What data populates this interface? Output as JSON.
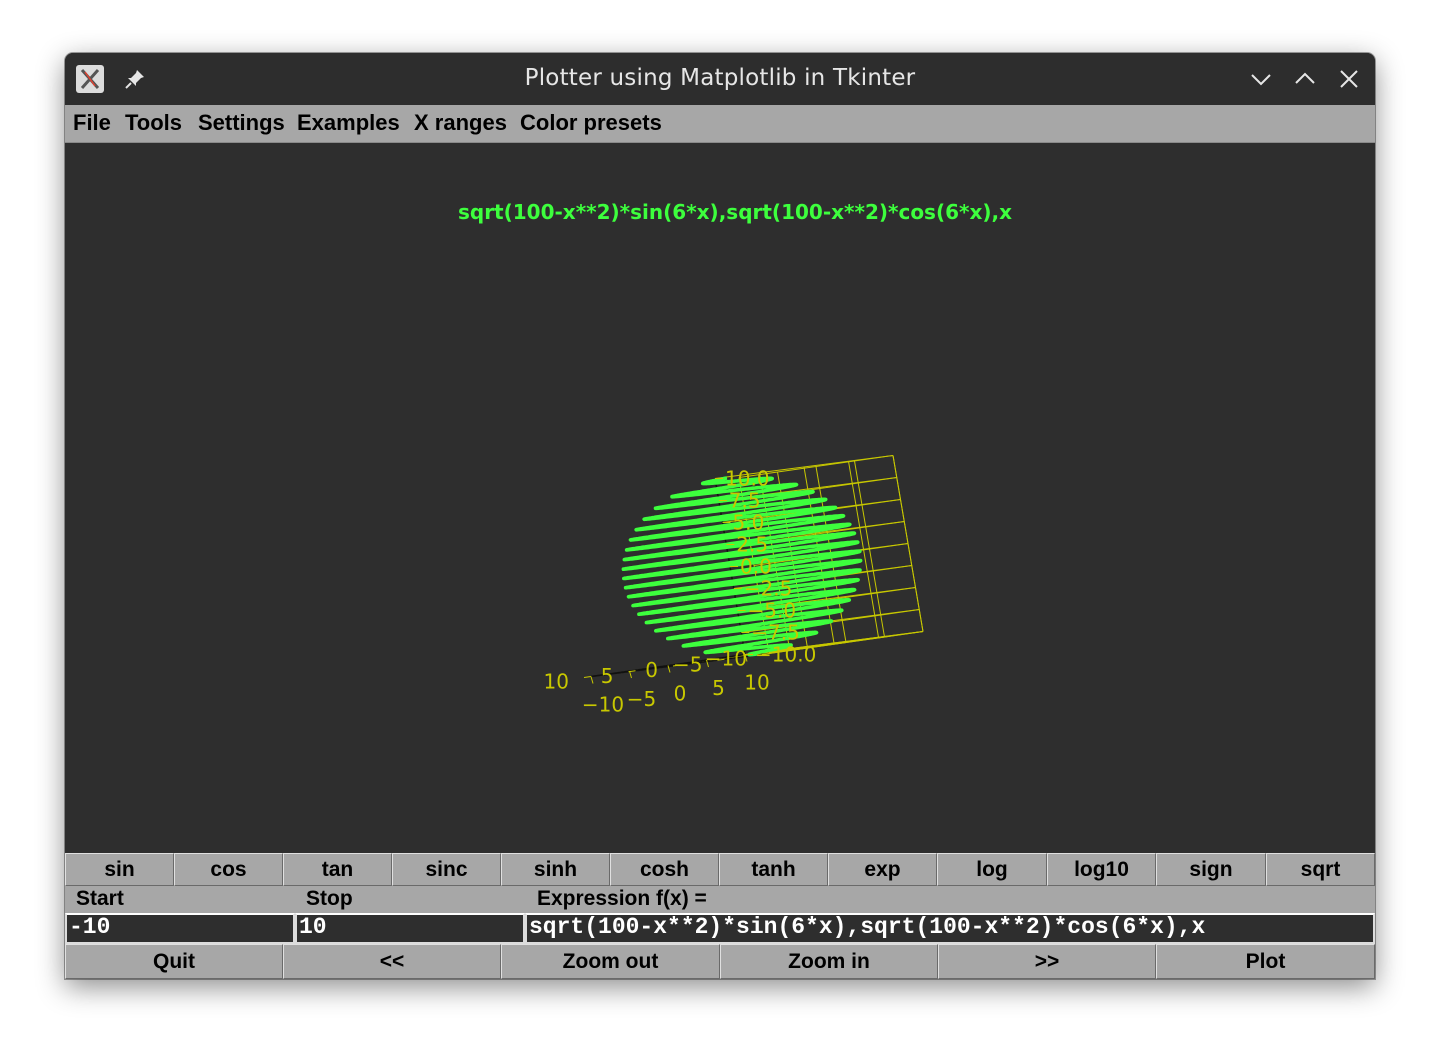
{
  "window": {
    "title": "Plotter using Matplotlib in Tkinter"
  },
  "titlebar_icons": [
    "app-icon",
    "pin-icon",
    "minimize-icon",
    "maximize-icon",
    "close-icon"
  ],
  "menu": [
    "File",
    "Tools",
    "Settings",
    "Examples",
    "X ranges",
    "Color presets"
  ],
  "function_buttons": [
    "sin",
    "cos",
    "tan",
    "sinc",
    "sinh",
    "cosh",
    "tanh",
    "exp",
    "log",
    "log10",
    "sign",
    "sqrt"
  ],
  "labels": {
    "start": "Start",
    "stop": "Stop",
    "expression": "Expression f(x) ="
  },
  "inputs": {
    "start": "-10",
    "stop": "10",
    "expression": "sqrt(100-x**2)*sin(6*x),sqrt(100-x**2)*cos(6*x),x"
  },
  "action_buttons": [
    "Quit",
    "<<",
    "Zoom out",
    "Zoom in",
    ">>",
    "Plot"
  ],
  "colors": {
    "plot_line": "#3dff3d",
    "axes": "#c8c800",
    "background": "#2e2e2e",
    "button": "#a7a7a7"
  },
  "chart_data": {
    "type": "line3d",
    "title": "sqrt(100-x**2)*sin(6*x),sqrt(100-x**2)*cos(6*x),x",
    "expression": {
      "x": "sqrt(100-x**2)*sin(6*x)",
      "y": "sqrt(100-x**2)*cos(6*x)",
      "z": "x"
    },
    "parameter_range": [
      -10,
      10
    ],
    "xlim": [
      -10,
      10
    ],
    "ylim": [
      -10,
      10
    ],
    "zlim": [
      -10,
      10
    ],
    "x_ticks": [
      "−10",
      "−5",
      "0",
      "5",
      "10"
    ],
    "y_ticks": [
      "−10",
      "−5",
      "0",
      "5",
      "10"
    ],
    "z_ticks": [
      "−10.0",
      "−7.5",
      "−5.0",
      "−2.5",
      "0.0",
      "2.5",
      "5.0",
      "7.5",
      "10.0"
    ],
    "grid": true
  }
}
